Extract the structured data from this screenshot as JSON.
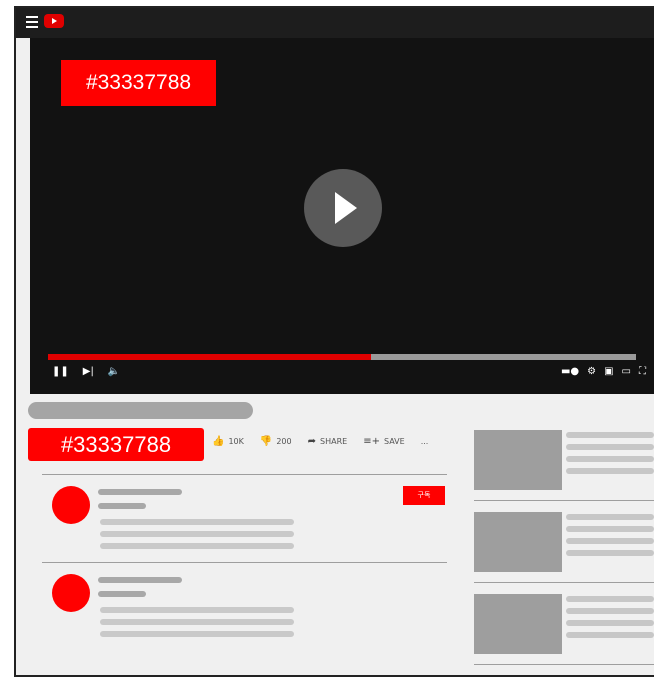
{
  "player": {
    "video_id_label": "#33337788",
    "progress_fraction": 0.55
  },
  "video_info": {
    "channel_label": "#33337788",
    "actions": [
      {
        "icon": "thumbs-up-icon",
        "label": "10K"
      },
      {
        "icon": "thumbs-down-icon",
        "label": "200"
      },
      {
        "icon": "share-icon",
        "label": "SHARE"
      },
      {
        "icon": "playlist-add-icon",
        "label": "SAVE"
      },
      {
        "icon": "more-icon",
        "label": "..."
      }
    ]
  },
  "comments": {
    "subscribe_label": "구독"
  },
  "colors": {
    "accent": "#ff0000",
    "player_bg": "#121212",
    "page_bg": "#f0f0f0"
  }
}
